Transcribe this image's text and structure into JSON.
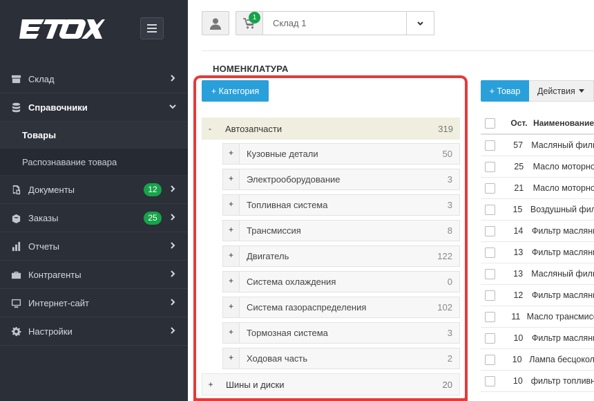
{
  "app": {
    "logo_text": "ETOX"
  },
  "sidebar": {
    "items": [
      {
        "label": "Склад",
        "icon": "warehouse-icon"
      },
      {
        "label": "Справочники",
        "icon": "database-icon",
        "expanded": true,
        "sub": [
          {
            "label": "Товары",
            "current": true
          },
          {
            "label": "Распознавание товара"
          }
        ]
      },
      {
        "label": "Документы",
        "icon": "documents-icon",
        "badge": "12"
      },
      {
        "label": "Заказы",
        "icon": "orders-box-icon",
        "badge": "25"
      },
      {
        "label": "Отчеты",
        "icon": "bar-chart-icon"
      },
      {
        "label": "Контрагенты",
        "icon": "briefcase-icon"
      },
      {
        "label": "Интернет-сайт",
        "icon": "monitor-icon"
      },
      {
        "label": "Настройки",
        "icon": "gear-icon"
      }
    ]
  },
  "topbar": {
    "cart_count": "1",
    "store": "Склад 1"
  },
  "page": {
    "title": "НОМЕНКЛАТУРА"
  },
  "categories": {
    "add_label": "+ Категория",
    "roots": [
      {
        "toggle": "-",
        "name": "Автозапчасти",
        "count": "319",
        "children": [
          {
            "toggle": "+",
            "name": "Кузовные детали",
            "count": "50"
          },
          {
            "toggle": "+",
            "name": "Электрооборудование",
            "count": "3"
          },
          {
            "toggle": "+",
            "name": "Топливная система",
            "count": "3"
          },
          {
            "toggle": "+",
            "name": "Трансмиссия",
            "count": "8"
          },
          {
            "toggle": "+",
            "name": "Двигатель",
            "count": "122"
          },
          {
            "toggle": "+",
            "name": "Система охлаждения",
            "count": "0"
          },
          {
            "toggle": "+",
            "name": "Система газораспределения",
            "count": "102"
          },
          {
            "toggle": "+",
            "name": "Тормозная система",
            "count": "3"
          },
          {
            "toggle": "+",
            "name": "Ходовая часть",
            "count": "2"
          }
        ]
      },
      {
        "toggle": "+",
        "name": "Шины и диски",
        "count": "20"
      }
    ]
  },
  "products": {
    "add_label": "+ Товар",
    "actions_label": "Действия",
    "columns": {
      "qty": "Ост.",
      "name": "Наименование"
    },
    "rows": [
      {
        "qty": "57",
        "name": "Масляный фильтр"
      },
      {
        "qty": "25",
        "name": "Масло моторное"
      },
      {
        "qty": "21",
        "name": "Масло моторное"
      },
      {
        "qty": "15",
        "name": "Воздушный фильтр"
      },
      {
        "qty": "14",
        "name": "Фильтр масляный"
      },
      {
        "qty": "13",
        "name": "Фильтр масляный"
      },
      {
        "qty": "13",
        "name": "Масляный фильтр"
      },
      {
        "qty": "12",
        "name": "Фильтр масляный"
      },
      {
        "qty": "11",
        "name": "Масло трансмиссионное"
      },
      {
        "qty": "10",
        "name": "Фильтр масляный"
      },
      {
        "qty": "10",
        "name": "Лампа бесцокольная"
      },
      {
        "qty": "10",
        "name": "фильтр топливный"
      }
    ]
  }
}
